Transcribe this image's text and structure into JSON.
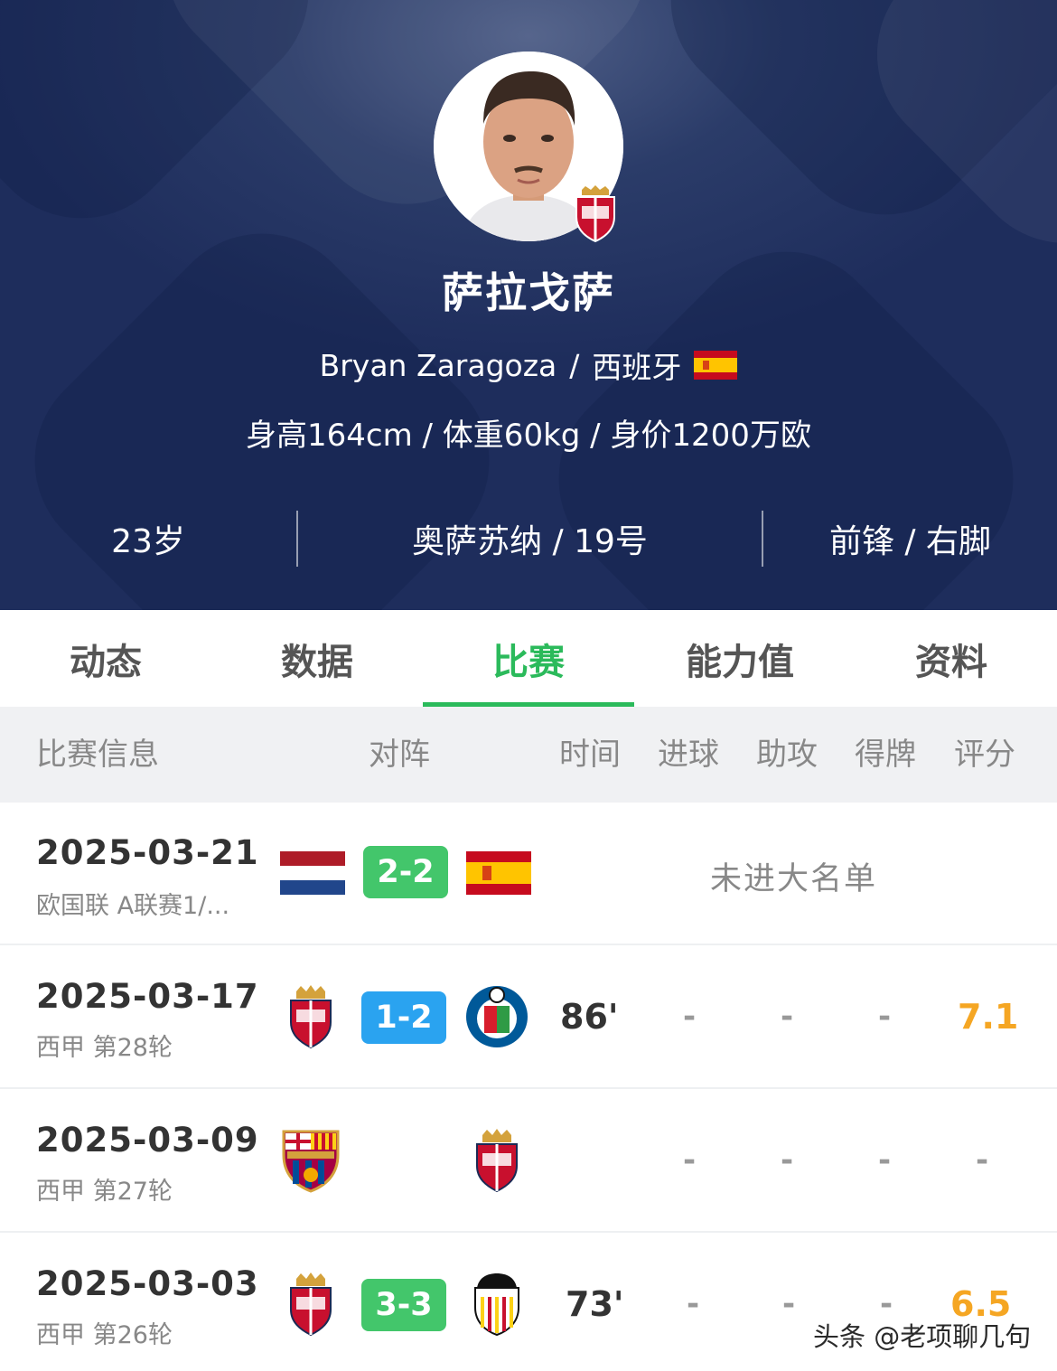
{
  "player": {
    "name": "萨拉戈萨",
    "english_name": "Bryan Zaragoza",
    "nationality": "西班牙",
    "body": "身高164cm / 体重60kg / 身价1200万欧",
    "age": "23岁",
    "club_number": "奥萨苏纳 / 19号",
    "position_foot": "前锋 / 右脚"
  },
  "tabs": [
    {
      "label": "动态"
    },
    {
      "label": "数据"
    },
    {
      "label": "比赛",
      "active": true
    },
    {
      "label": "能力值"
    },
    {
      "label": "资料"
    }
  ],
  "table_header": {
    "info": "比赛信息",
    "matchup": "对阵",
    "time": "时间",
    "goals": "进球",
    "assists": "助攻",
    "cards": "得牌",
    "rating": "评分"
  },
  "matches": [
    {
      "date": "2025-03-21",
      "competition": "欧国联 A联赛1/...",
      "home": "netherlands-flag",
      "away": "spain-flag",
      "score": "2-2",
      "score_color": "#43c66b",
      "status": "未进大名单"
    },
    {
      "date": "2025-03-17",
      "competition": "西甲 第28轮",
      "home": "osasuna-crest",
      "away": "getafe-crest",
      "score": "1-2",
      "score_color": "#2aa3f0",
      "minutes": "86'",
      "goals": "-",
      "assists": "-",
      "cards": "-",
      "rating": "7.1"
    },
    {
      "date": "2025-03-09",
      "competition": "西甲 第27轮",
      "home": "barcelona-crest",
      "away": "osasuna-crest",
      "minutes": "",
      "goals": "-",
      "assists": "-",
      "cards": "-",
      "rating": "-"
    },
    {
      "date": "2025-03-03",
      "competition": "西甲 第26轮",
      "home": "osasuna-crest",
      "away": "valencia-crest",
      "score": "3-3",
      "score_color": "#43c66b",
      "minutes": "73'",
      "goals": "-",
      "assists": "-",
      "cards": "-",
      "rating": "6.5"
    }
  ],
  "watermark": "头条 @老项聊几句",
  "colors": {
    "accent": "#2bba5b",
    "header_bg": "#22325f",
    "rating": "#f5a623"
  }
}
